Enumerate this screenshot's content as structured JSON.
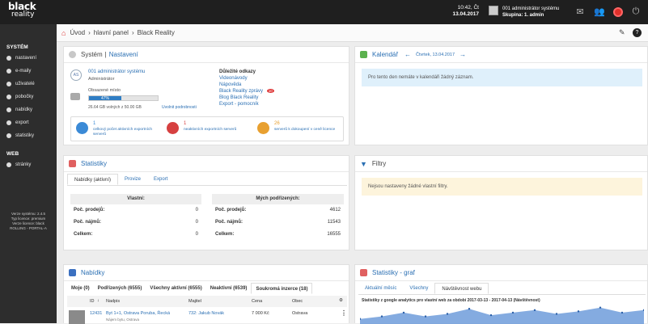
{
  "brand": {
    "line1": "black",
    "line2": "reality"
  },
  "topbar": {
    "time": "10:42, Čt",
    "date": "13.04.2017",
    "user_name": "001 administrátor systému",
    "user_group": "Skupina: 1. admin"
  },
  "sidebar": {
    "system_heading": "SYSTÉM",
    "system_items": [
      "nastavení",
      "e-maily",
      "uživatelé",
      "pobočky",
      "nabídky",
      "export",
      "statistiky"
    ],
    "web_heading": "WEB",
    "web_items": [
      "stránky"
    ],
    "version": [
      "Verze systému: 2.4.5",
      "Typ licence: premium",
      "Verze licence: black",
      "ROLLING - PORTAL-A"
    ]
  },
  "breadcrumb": {
    "home": "Úvod",
    "dashboard": "hlavní panel",
    "current": "Black Reality"
  },
  "system_panel": {
    "title_a": "Systém",
    "sep": "|",
    "title_b": "Nastavení",
    "avatar_initials": "AS",
    "admin_name": "001 administrátor systému",
    "admin_role": "Administrátor",
    "storage_label": "Obsazené místo",
    "storage_percent": "47%",
    "storage_value": 0.47,
    "storage_detail": "26.64 GB volných z 50.00 GB",
    "storage_link": "Uvolnit podrobnosti",
    "links_title": "Důležité odkazy",
    "links": [
      "Videonávody",
      "Nápověda",
      "Black Reality zprávy",
      "Blog Black Reality",
      "Export - pomocník"
    ],
    "news_badge": "10",
    "stats": [
      {
        "num": "1",
        "label": "celkový počet aktivních exportních serverů",
        "color": "#3b8ad6"
      },
      {
        "num": "1",
        "label": "neaktivních exportních serverů",
        "color": "#d64040"
      },
      {
        "num": "26",
        "label": "serverů k dokoupení v ceně licence",
        "color": "#e8a030"
      }
    ]
  },
  "calendar_panel": {
    "title": "Kalendář",
    "date": "Čtvrtek, 13.04.2017",
    "empty": "Pro tento den nemáte v kalendáři žádný záznam."
  },
  "stats_panel": {
    "title": "Statistiky",
    "tabs": [
      "Nabídky (aktivní)",
      "Provize",
      "Export"
    ],
    "own_header": "Vlastní:",
    "sub_header": "Mých podřízených:",
    "rows": [
      {
        "label": "Poč. prodejů:",
        "own": "0",
        "sub": "4612"
      },
      {
        "label": "Poč. nájmů:",
        "own": "0",
        "sub": "11543"
      },
      {
        "label": "Celkem:",
        "own": "0",
        "sub": "16555"
      }
    ]
  },
  "filters_panel": {
    "title": "Filtry",
    "empty": "Nejsou nastaveny žádné vlastní filtry."
  },
  "offers_panel": {
    "title": "Nabídky",
    "tabs": [
      "Moje   (0)",
      "Podřízených (6555)",
      "Všechny aktivní (6555)",
      "Neaktivní (6539)",
      "Soukromá inzerce (18)"
    ],
    "columns": [
      "ID",
      "Nadpis",
      "Majitel",
      "Cena",
      "Obec"
    ],
    "row": {
      "id": "12431",
      "title": "Byt 1+1, Ostrava Poruba, Řecká",
      "subtitle": "Nájem bytu, Ostrava",
      "owner": "732: Jakub Novák",
      "price": "7 000 Kč",
      "city": "Ostrava"
    }
  },
  "graph_panel": {
    "title": "Statistiky - graf",
    "tabs": [
      "Aktuální měsíc",
      "Všechny",
      "Návštěvnost webu"
    ],
    "caption": "Statistiky z google analytics pro vlastní web za období 2017-03-13 - 2017-04-13 (Návštěvnost)"
  },
  "chart_data": {
    "type": "area",
    "series": [
      {
        "values": [
          4,
          6,
          9,
          6,
          8,
          12,
          7,
          9,
          11,
          8,
          10,
          13,
          9,
          11
        ]
      }
    ],
    "ylim": [
      0,
      16
    ]
  }
}
